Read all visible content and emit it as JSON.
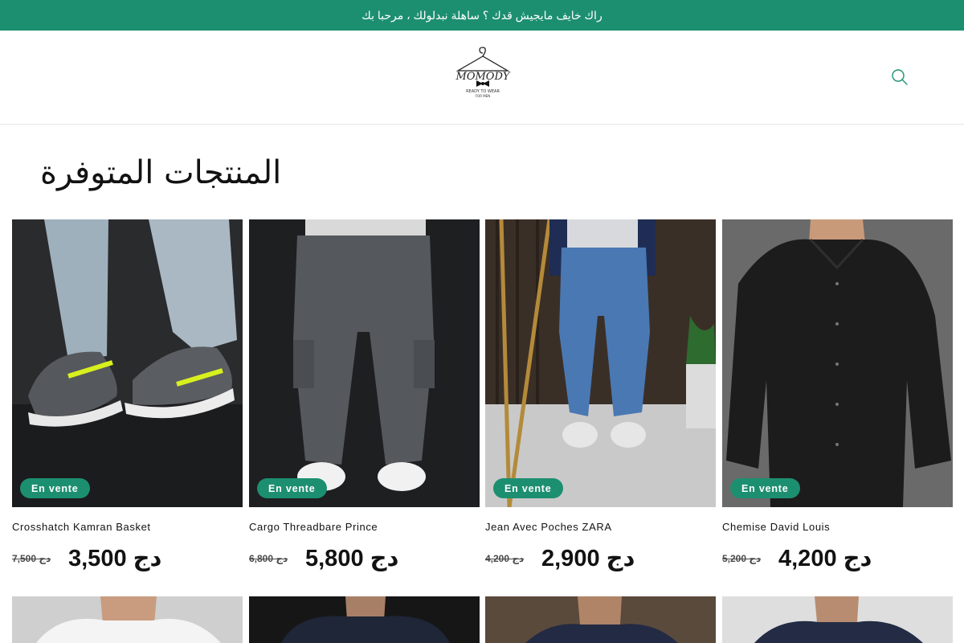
{
  "announcement": {
    "text": "راك خايف مايجيش قدك ؟ ساهلة نبدلولك ، مرحبا بك"
  },
  "header": {
    "logo_icon": "hanger-bowtie-logo",
    "logo_text": "MOMODY",
    "logo_tagline_1": "READY TO WEAR",
    "logo_tagline_2": "FOR MEN",
    "search_icon": "search-icon"
  },
  "section": {
    "title": "المنتجات المتوفرة"
  },
  "colors": {
    "accent": "#1d8f71",
    "text": "#121212"
  },
  "products": [
    {
      "title": "Crosshatch Kamran Basket",
      "badge": "En vente",
      "price_old": "7,500 دج",
      "price_new": "3,500 دج",
      "image_icon": "sneakers-photo"
    },
    {
      "title": "Cargo Threadbare Prince",
      "badge": "En vente",
      "price_old": "6,800 دج",
      "price_new": "5,800 دج",
      "image_icon": "cargo-pants-photo"
    },
    {
      "title": "Jean Avec Poches ZARA",
      "badge": "En vente",
      "price_old": "4,200 دج",
      "price_new": "2,900 دج",
      "image_icon": "jeans-photo"
    },
    {
      "title": "Chemise David Louis",
      "badge": "En vente",
      "price_old": "5,200 دج",
      "price_new": "4,200 دج",
      "image_icon": "black-shirt-photo"
    }
  ],
  "products_row2": [
    {
      "image_icon": "white-shirt-photo"
    },
    {
      "image_icon": "puffer-jacket-photo"
    },
    {
      "image_icon": "polo-shirt-photo"
    },
    {
      "image_icon": "navy-sweater-photo"
    }
  ]
}
